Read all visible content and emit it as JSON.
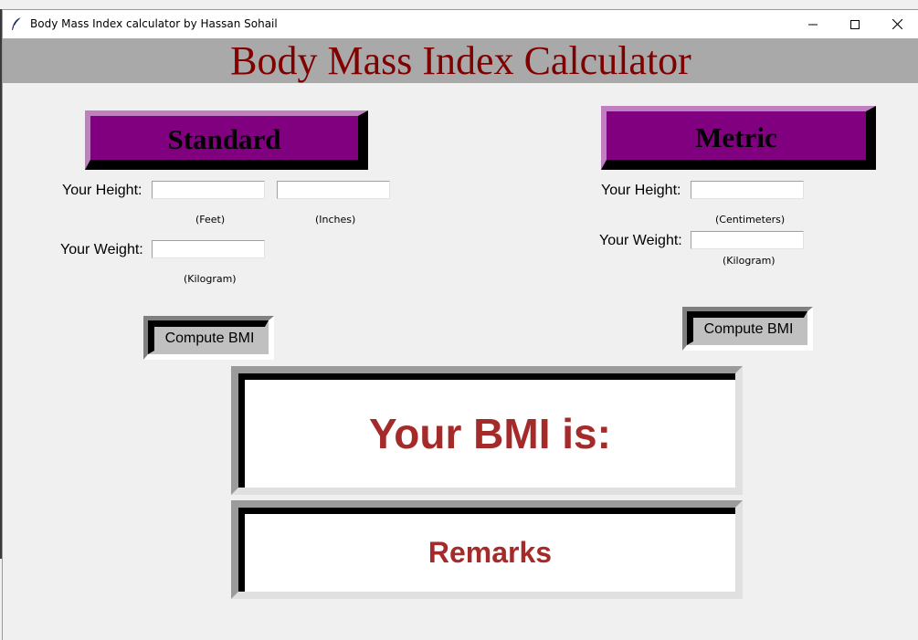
{
  "window": {
    "title": "Body Mass Index calculator by Hassan Sohail"
  },
  "banner": {
    "title": "Body Mass Index Calculator"
  },
  "standard": {
    "header": "Standard",
    "height_label": "Your Height:",
    "feet_unit": "(Feet)",
    "inches_unit": "(Inches)",
    "weight_label": "Your Weight:",
    "weight_unit": "(Kilogram)",
    "compute_label": "Compute BMI",
    "feet_value": "",
    "inches_value": "",
    "weight_value": ""
  },
  "metric": {
    "header": "Metric",
    "height_label": "Your Height:",
    "height_unit": "(Centimeters)",
    "weight_label": "Your Weight:",
    "weight_unit": "(Kilogram)",
    "compute_label": "Compute BMI",
    "height_value": "",
    "weight_value": ""
  },
  "result": {
    "bmi_text": "Your BMI is:",
    "remarks_text": "Remarks"
  },
  "colors": {
    "banner_text": "#800000",
    "header_button": "#800080",
    "result_text": "#a52a2a"
  }
}
